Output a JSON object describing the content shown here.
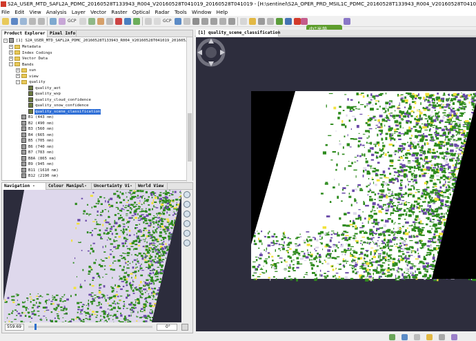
{
  "window": {
    "title": "S2A_USER_MTD_SAFL2A_PDMC_20160528T133943_R004_V20160528T041019_20160528T041019 - [H:\\sentinel\\S2A_OPER_PRD_MSIL1C_PDMC_20160528T133943_R004_V20160528T041019_20160528T041019\\S2A_USER_PRD_MSIL2A_PDMC_2016"
  },
  "menubar": {
    "items": [
      "File",
      "Edit",
      "View",
      "Analysis",
      "Layer",
      "Vector",
      "Raster",
      "Optical",
      "Radar",
      "Tools",
      "Window",
      "Help"
    ]
  },
  "toolbar": {
    "gcp_label_1": "GCP",
    "gcp_label_2": "GCP"
  },
  "ime": {
    "label": "中°半简"
  },
  "left_panel": {
    "tabs": [
      "Product Explorer",
      "Pixel Info"
    ],
    "tree": {
      "product": "[1] S2A_USER_MTD_SAFL2A_PDMC_20160528T133943_R004_V20160528T041019_20160528T041019",
      "groups": [
        "Metadata",
        "Index Codings",
        "Vector Data",
        "Bands"
      ],
      "band_subgroups": [
        "sun",
        "view",
        "quality"
      ],
      "quality_bands": [
        "quality_aot",
        "quality_wvp",
        "quality_cloud_confidence",
        "quality_snow_confidence",
        "quality_scene_classification"
      ],
      "selected": "quality_scene_classification",
      "bands": [
        "B1 (443 nm)",
        "B2 (490 nm)",
        "B3 (560 nm)",
        "B4 (665 nm)",
        "B5 (705 nm)",
        "B6 (740 nm)",
        "B7 (783 nm)",
        "B8A (865 nm)",
        "B9 (945 nm)",
        "B11 (1610 nm)",
        "B12 (2190 nm)"
      ]
    }
  },
  "nav_panel": {
    "tabs": [
      "Navigation -",
      "Colour Manipul-",
      "Uncertainty Vi-",
      "World View"
    ],
    "zoom_value": "559.69",
    "rotation_value": "0°",
    "zoom_level": 0.05
  },
  "image_view": {
    "tab": "[1] quality_scene_classification"
  },
  "colors": {
    "vegetation": "#2e8b1e",
    "cloud": "#ffffff",
    "cirrus": "#ded8ec",
    "snow": "#f2e23a",
    "shadow": "#6a4aa8",
    "nodata": "#000000",
    "nav_nodata": "#2c2c3c",
    "selection": "#2f6fd6"
  }
}
